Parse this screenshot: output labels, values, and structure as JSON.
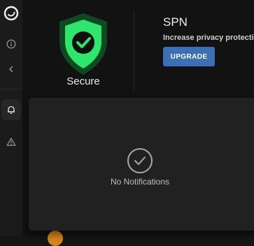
{
  "sidebar": {
    "items": [
      {
        "icon": "app-logo-icon"
      },
      {
        "icon": "info-icon"
      },
      {
        "icon": "chevron-left-icon"
      },
      {
        "icon": "bell-icon",
        "active": true
      },
      {
        "icon": "warning-icon"
      }
    ]
  },
  "status": {
    "label": "Secure",
    "icon": "shield-check-icon",
    "color": "#2ee66b"
  },
  "spn": {
    "title": "SPN",
    "description": "Increase privacy protecti",
    "upgrade_label": "UPGRADE",
    "button_color": "#3d6fb6"
  },
  "notifications": {
    "empty_text": "No Notifications",
    "icon": "check-circle-icon"
  }
}
